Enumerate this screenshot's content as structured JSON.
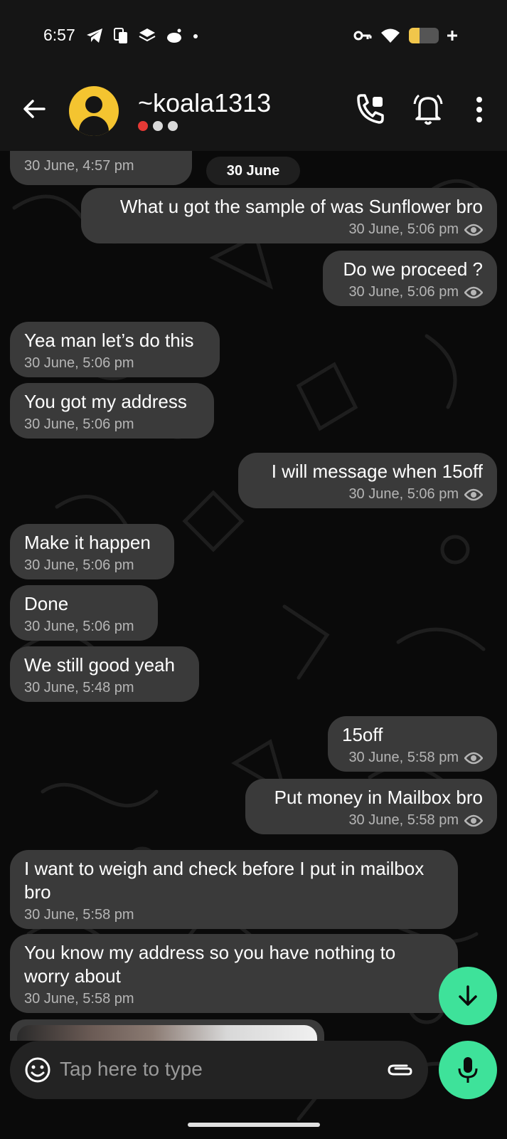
{
  "status_bar": {
    "time": "6:57",
    "battery_level": 0.35
  },
  "header": {
    "contact_name": "~koala1313",
    "colors": {
      "avatar": "#f4c430",
      "dot_red": "#e53935",
      "dot_grey": "#d9d9d9"
    }
  },
  "chat": {
    "date_separator": "30 June",
    "top_partial_time": "30 June, 4:57 pm",
    "messages": [
      {
        "direction": "out",
        "text": "What u got the sample of was Sunflower bro",
        "time": "30 June, 5:06 pm"
      },
      {
        "direction": "out",
        "text": "Do we proceed ?",
        "time": "30 June, 5:06 pm"
      },
      {
        "direction": "in",
        "text": "Yea man let’s do this",
        "time": "30 June, 5:06 pm"
      },
      {
        "direction": "in",
        "text": "You got my address",
        "time": "30 June, 5:06 pm"
      },
      {
        "direction": "out",
        "text": "I will message when 15off",
        "time": "30 June, 5:06 pm"
      },
      {
        "direction": "in",
        "text": "Make it happen",
        "time": "30 June, 5:06 pm"
      },
      {
        "direction": "in",
        "text": "Done",
        "time": "30 June, 5:06 pm"
      },
      {
        "direction": "in",
        "text": "We still good yeah",
        "time": "30 June, 5:48 pm"
      },
      {
        "direction": "out",
        "text": "15off",
        "time": "30 June, 5:58 pm"
      },
      {
        "direction": "out",
        "text": "Put money in Mailbox bro",
        "time": "30 June, 5:58 pm"
      },
      {
        "direction": "in",
        "text": "I want to weigh and check before I put in mailbox bro",
        "time": "30 June, 5:58 pm"
      },
      {
        "direction": "in",
        "text": "You know my address so you have nothing to worry about",
        "time": "30 June, 5:58 pm"
      }
    ]
  },
  "composer": {
    "placeholder": "Tap here to type"
  },
  "colors": {
    "accent": "#3ee29a",
    "bubble": "#3a3a3a"
  }
}
